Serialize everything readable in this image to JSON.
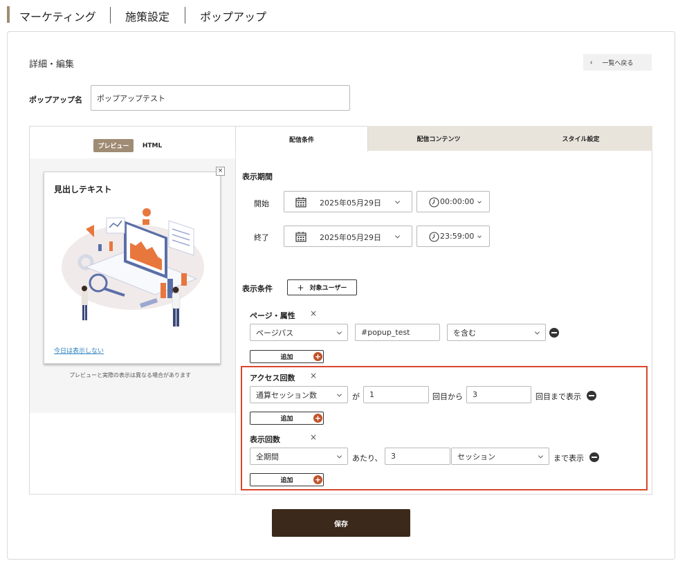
{
  "breadcrumb": {
    "items": [
      "マーケティング",
      "施策設定",
      "ポップアップ"
    ]
  },
  "header": {
    "title": "詳細・編集",
    "back_label": "一覧へ戻る"
  },
  "name_field": {
    "label": "ポップアップ名",
    "value": "ポップアップテスト"
  },
  "preview": {
    "tab_preview": "プレビュー",
    "tab_html": "HTML",
    "popup_heading": "見出しテキスト",
    "dismiss_link": "今日は表示しない",
    "note": "プレビューと実際の表示は異なる場合があります",
    "close": "×"
  },
  "tabs": [
    "配信条件",
    "配信コンテンツ",
    "スタイル設定"
  ],
  "period": {
    "heading": "表示期間",
    "start_label": "開始",
    "start_date": "2025年05月29日",
    "start_time": "00:00:00",
    "end_label": "終了",
    "end_date": "2025年05月29日",
    "end_time": "23:59:00"
  },
  "conditions": {
    "heading": "表示条件",
    "target_btn": "対象ユーザー",
    "add_label": "追加",
    "page_attr": {
      "label": "ページ・属性",
      "select": "ページパス",
      "value": "#popup_test",
      "operator": "を含む"
    },
    "access": {
      "label": "アクセス回数",
      "select": "通算セッション数",
      "ga": "が",
      "from_value": "1",
      "from_suffix": "回目から",
      "to_value": "3",
      "to_suffix": "回目まで表示"
    },
    "display": {
      "label": "表示回数",
      "select": "全期間",
      "per": "あたり、",
      "count": "3",
      "unit": "セッション",
      "suffix": "まで表示"
    }
  },
  "save_label": "保存",
  "colors": {
    "accent": "#a08b74",
    "dark": "#3b2a1c",
    "tab_bg": "#e8e3db",
    "highlight": "#d9452b",
    "add_icon": "#c0522a"
  }
}
